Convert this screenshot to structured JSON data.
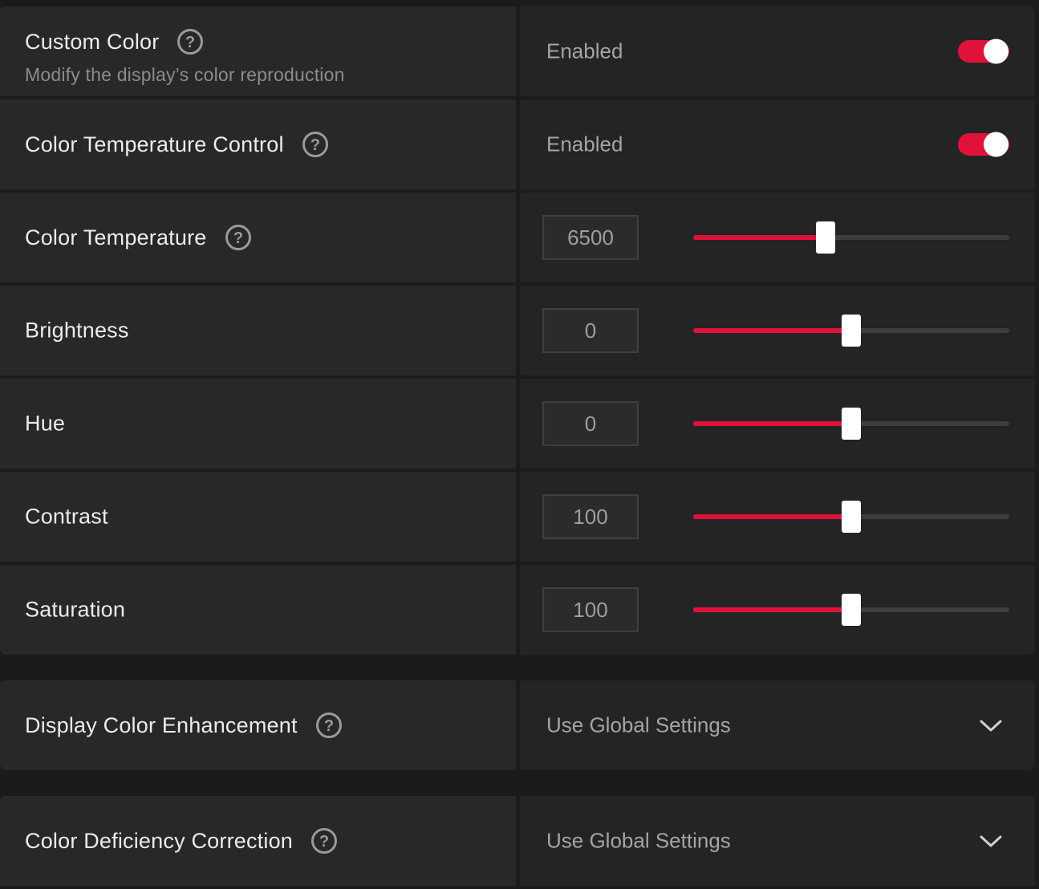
{
  "colors": {
    "accent": "#e0123a",
    "panel_left": "#282828",
    "panel_right": "#242424",
    "background": "#1b1b1b"
  },
  "custom_color": {
    "label": "Custom Color",
    "description": "Modify the display’s color reproduction",
    "status": "Enabled",
    "toggle_on": true,
    "help_icon": "help-circle-icon"
  },
  "color_temperature_control": {
    "label": "Color Temperature Control",
    "status": "Enabled",
    "toggle_on": true,
    "help_icon": "help-circle-icon"
  },
  "sliders": [
    {
      "key": "color_temperature",
      "label": "Color Temperature",
      "value": "6500",
      "fraction": 0.42,
      "help": true
    },
    {
      "key": "brightness",
      "label": "Brightness",
      "value": "0",
      "fraction": 0.5,
      "help": false
    },
    {
      "key": "hue",
      "label": "Hue",
      "value": "0",
      "fraction": 0.5,
      "help": false
    },
    {
      "key": "contrast",
      "label": "Contrast",
      "value": "100",
      "fraction": 0.5,
      "help": false
    },
    {
      "key": "saturation",
      "label": "Saturation",
      "value": "100",
      "fraction": 0.5,
      "help": false
    }
  ],
  "display_color_enhancement": {
    "label": "Display Color Enhancement",
    "value": "Use Global Settings",
    "icon": "chevron-down-icon"
  },
  "color_deficiency_correction": {
    "label": "Color Deficiency Correction",
    "value": "Use Global Settings",
    "icon": "chevron-down-icon"
  }
}
